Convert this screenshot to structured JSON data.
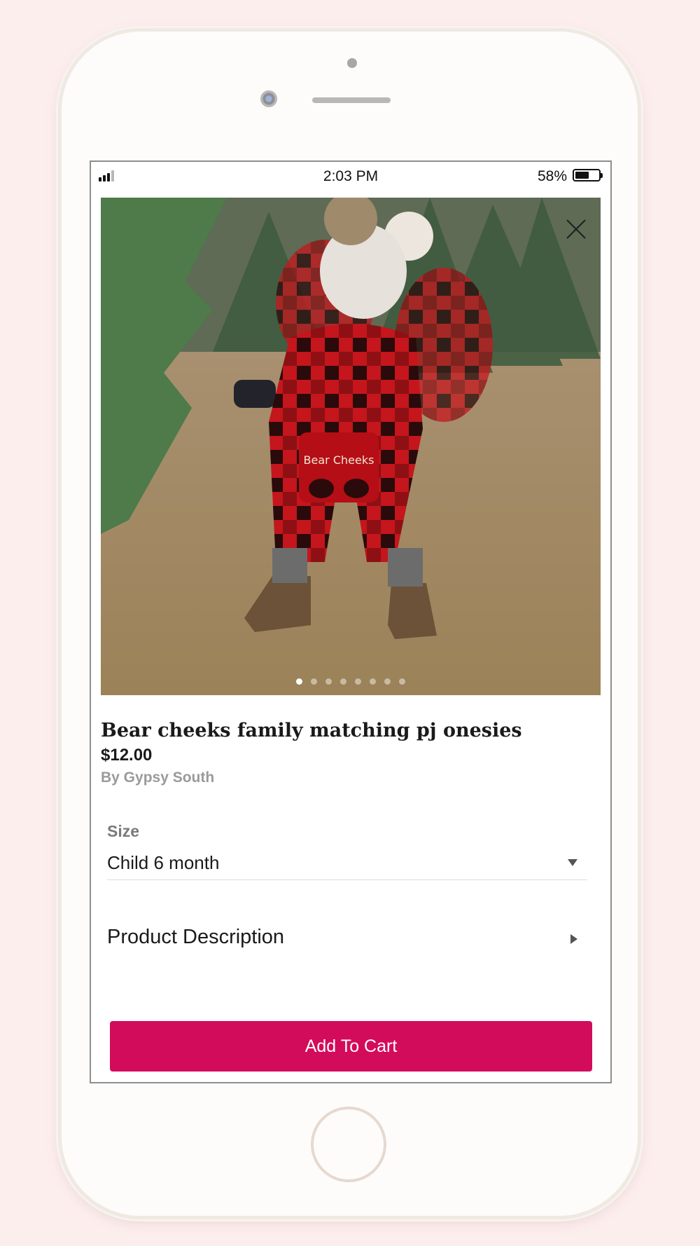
{
  "status_bar": {
    "time": "2:03 PM",
    "battery_percent": "58%",
    "battery_level": 0.58,
    "signal_bars": 3
  },
  "product": {
    "gallery": {
      "image_alt": "Toddler in red buffalo plaid bear cheeks onesie and pom-pom hat",
      "slide_count": 8,
      "active_slide": 1
    },
    "title": "Bear cheeks family matching pj onesies",
    "price": "$12.00",
    "vendor": "By Gypsy South",
    "size_label": "Size",
    "size_value": "Child 6 month",
    "description_label": "Product Description",
    "add_to_cart_label": "Add To Cart"
  },
  "colors": {
    "accent": "#d30b5b",
    "page_background": "#fdeeee"
  },
  "icons": [
    "close-icon",
    "chevron-down-icon",
    "chevron-right-icon",
    "signal-icon",
    "battery-icon"
  ]
}
